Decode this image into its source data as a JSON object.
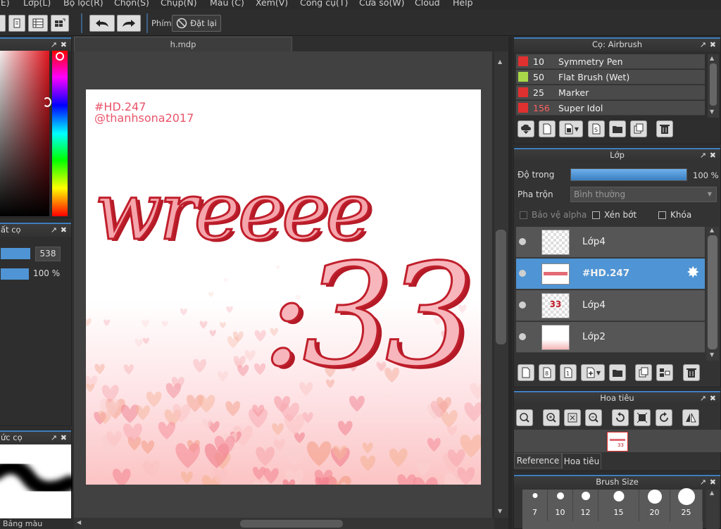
{
  "menu": [
    "(E)",
    "Lớp(L)",
    "Bộ lọc(R)",
    "Chọn(S)",
    "Chụp(N)",
    "Màu (C)",
    "Xem(V)",
    "Công cụ(T)",
    "Cửa sổ(W)",
    "Cloud",
    "Help"
  ],
  "toolbar": {
    "phim_label": "Phím",
    "reset_label": "Đặt lại"
  },
  "document_tab": "h.mdp",
  "canvas_text": {
    "line1": "#HD.247",
    "line2": "@thanhsona2017",
    "word": "wreeee",
    "emote": ":33"
  },
  "left_panels": {
    "brush_settings_title": "ất cọ",
    "size_value": "538",
    "opacity_value": "100 %",
    "brush_preview_title": "ức cọ",
    "palette_tab": "Bảng màu"
  },
  "brush_panel": {
    "title": "Cọ: Airbrush",
    "brushes": [
      {
        "size": "10",
        "name": "Symmetry Pen",
        "color": "#e03030",
        "size_color": "#f0f0f0"
      },
      {
        "size": "50",
        "name": "Flat Brush (Wet)",
        "color": "#a8d84a",
        "size_color": "#f0f0f0"
      },
      {
        "size": "25",
        "name": "Marker",
        "color": "#e03030",
        "size_color": "#f0f0f0"
      },
      {
        "size": "156",
        "name": "Super Idol",
        "color": "#e03030",
        "size_color": "#ff6060"
      }
    ]
  },
  "layer_panel": {
    "title": "Lớp",
    "opacity_label": "Độ trong",
    "opacity_value": "100 %",
    "opacity_fraction": 1.0,
    "blend_label": "Pha trộn",
    "blend_value": "Bình thường",
    "protect_alpha": "Bảo vệ alpha",
    "clipping": "Xén bớt",
    "lock": "Khóa",
    "layers": [
      {
        "name": "Lớp4",
        "selected": false
      },
      {
        "name": "#HD.247",
        "selected": true
      },
      {
        "name": "Lớp4",
        "selected": false
      },
      {
        "name": "Lớp2",
        "selected": false
      }
    ]
  },
  "navigator": {
    "title": "Hoa tiêu",
    "tab_reference": "Reference",
    "tab_navigator": "Hoa tiêu"
  },
  "brush_size_panel": {
    "title": "Brush Size",
    "sizes": [
      "7",
      "10",
      "12",
      "15",
      "20",
      "25"
    ]
  },
  "colors": {
    "accent": "#4f94d4",
    "pink": "#e8546a"
  }
}
